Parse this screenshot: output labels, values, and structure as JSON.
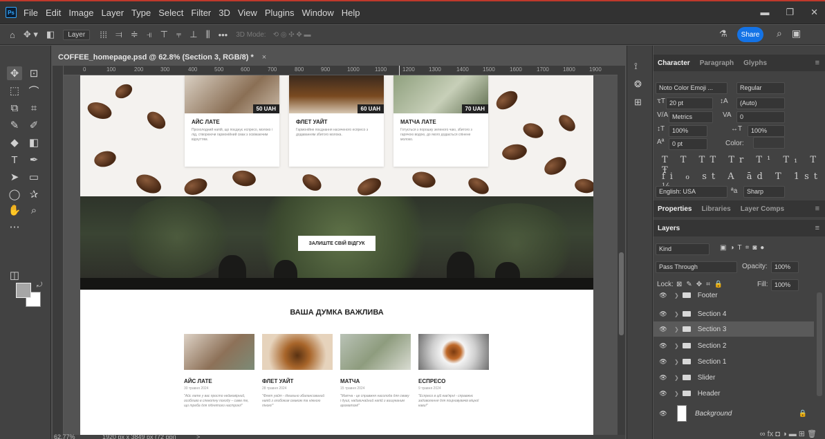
{
  "app": {
    "title": "Photoshop",
    "logo": "Ps"
  },
  "menu": [
    "File",
    "Edit",
    "Image",
    "Layer",
    "Type",
    "Select",
    "Filter",
    "3D",
    "View",
    "Plugins",
    "Window",
    "Help"
  ],
  "options_bar": {
    "layer_dropdown": "Layer",
    "mode_label": "3D Mode:",
    "share_label": "Share",
    "more": "•••"
  },
  "document": {
    "tab_title": "COFFEE_homepage.psd @ 62.8% (Section 3, RGB/8) *",
    "close": "×"
  },
  "ruler_ticks": [
    "0",
    "100",
    "200",
    "300",
    "400",
    "500",
    "600",
    "700",
    "800",
    "900",
    "1000",
    "1100",
    "1200",
    "1300",
    "1400",
    "1500",
    "1600",
    "1700",
    "1800",
    "1900"
  ],
  "status": {
    "zoom": "62.77%",
    "dimensions": "1920 px x 3849 px (72 ppi)",
    "arrow": ">"
  },
  "canvas": {
    "products": [
      {
        "price": "50 UAH",
        "name": "АЙС ЛАТЕ",
        "desc": "Прохолодний напій, що поєднує еспресо, молоко і лід, створюючи гармонійний смак з освіжаючим відчуттям."
      },
      {
        "price": "60 UAH",
        "name": "ФЛЕТ УАЙТ",
        "desc": "Гармонійне поєднання насиченого еспресо з додаванням збитого молока."
      },
      {
        "price": "70 UAH",
        "name": "МАТЧА ЛАТЕ",
        "desc": "Готується з порошку зеленого чаю, збитого з гарячою водою, до якого додається спінене молоко."
      }
    ],
    "review_button": "ЗАЛИШТЕ СВІЙ ВІДГУК",
    "opinion_title": "ВАША ДУМКА ВАЖЛИВА",
    "reviews": [
      {
        "name": "АЙС ЛАТЕ",
        "date": "30 травня 2024",
        "text": "\"Айс лате у вас просто неймовірний, особливо в спекотну погоду – саме те, що треба для піднятого настрою!\""
      },
      {
        "name": "ФЛЕТ УАЙТ",
        "date": "28 травня 2024",
        "text": "\"Флет уайт - ідеально збалансований напій з глибоким смаком та ніжною піною!\""
      },
      {
        "name": "МАТЧА",
        "date": "15 травня 2024",
        "text": "\"Матча - це справжня насолода для смаку і душі, надзвичайний напій з вишуканим ароматом!\""
      },
      {
        "name": "ЕСПРЕСО",
        "date": "9 травня 2024",
        "text": "\"Еспресо в цій кав'ярні - справжнє задоволення для поціновувачів міцної кави!\""
      }
    ]
  },
  "character_panel": {
    "tabs": [
      "Character",
      "Paragraph",
      "Glyphs"
    ],
    "font_family": "Noto Color Emoji ...",
    "font_style": "Regular",
    "font_size": "20 pt",
    "leading": "(Auto)",
    "kerning": "Metrics",
    "tracking": "0",
    "vertical_scale": "100%",
    "horizontal_scale": "100%",
    "baseline_shift": "0 pt",
    "color_label": "Color:",
    "language": "English: USA",
    "antialias": "Sharp",
    "aa_icon": "ªa",
    "style_row1": "T T TT Tr T¹ T₁ T Ŧ",
    "style_row2": "fi ℴ st A ād T 1st ½"
  },
  "properties_tabs": [
    "Properties",
    "Libraries",
    "Layer Comps"
  ],
  "layers_panel": {
    "tab": "Layers",
    "filter_kind": "Kind",
    "blend_mode": "Pass Through",
    "opacity_label": "Opacity:",
    "opacity": "100%",
    "lock_label": "Lock:",
    "fill_label": "Fill:",
    "fill": "100%",
    "layers": [
      {
        "name": "Footer",
        "selected": false
      },
      {
        "name": "Section 4",
        "selected": false
      },
      {
        "name": "Section 3",
        "selected": true
      },
      {
        "name": "Section 2",
        "selected": false
      },
      {
        "name": "Section 1",
        "selected": false
      },
      {
        "name": "Slider",
        "selected": false
      },
      {
        "name": "Header",
        "selected": false
      }
    ],
    "background_layer": "Background",
    "bottom_icons": "∞ fx ◘ ◑ ▬ ⊞ 🗑"
  }
}
